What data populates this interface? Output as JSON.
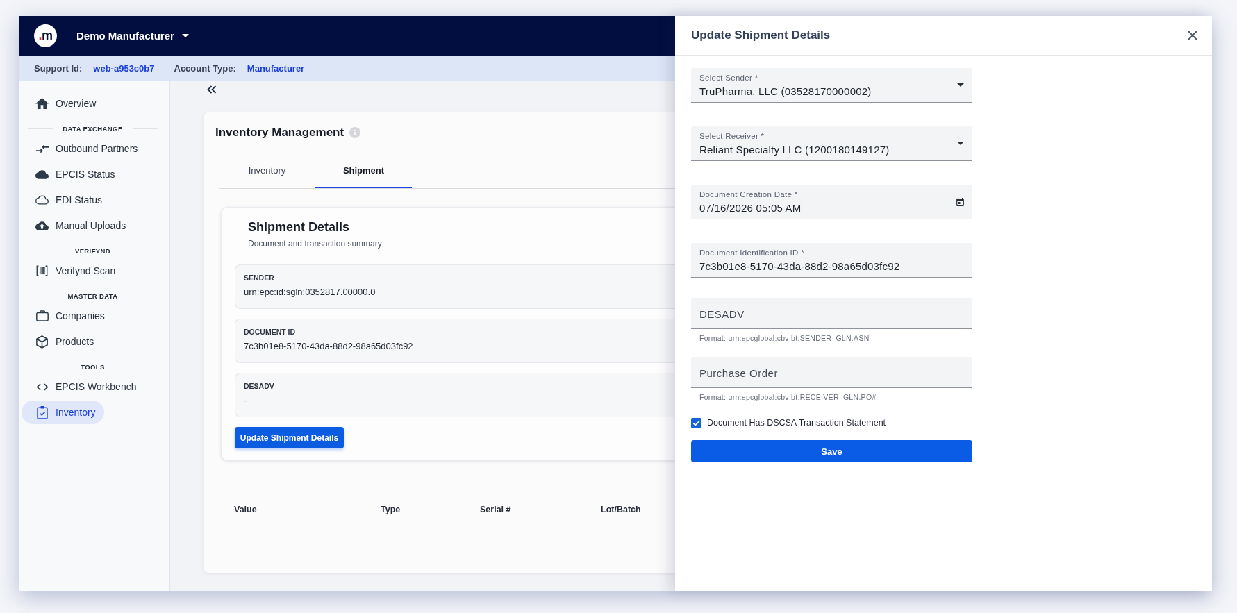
{
  "top_bar": {
    "logo": {
      "dot": ".",
      "letter": "m"
    },
    "organization": "Demo Manufacturer"
  },
  "account_bar": {
    "support_id_label": "Support Id:",
    "support_id": "web-a953c0b7",
    "account_type_label": "Account Type:",
    "account_type": "Manufacturer"
  },
  "sidebar": {
    "groups": [
      {
        "items": [
          {
            "label": "Overview",
            "selected": false
          }
        ]
      },
      {
        "heading": "DATA EXCHANGE",
        "items": [
          {
            "label": "Outbound Partners",
            "selected": false
          },
          {
            "label": "EPCIS Status",
            "selected": false
          },
          {
            "label": "EDI Status",
            "selected": false
          },
          {
            "label": "Manual Uploads",
            "selected": false
          }
        ]
      },
      {
        "heading": "VERIFYND",
        "items": [
          {
            "label": "Verifynd Scan",
            "selected": false
          }
        ]
      },
      {
        "heading": "MASTER DATA",
        "items": [
          {
            "label": "Companies",
            "selected": false
          },
          {
            "label": "Products",
            "selected": false
          }
        ]
      },
      {
        "heading": "TOOLS",
        "items": [
          {
            "label": "EPCIS Workbench",
            "selected": false
          },
          {
            "label": "Inventory",
            "selected": true
          }
        ]
      }
    ]
  },
  "inventory_card": {
    "title": "Inventory Management",
    "tabs": [
      {
        "label": "Inventory",
        "selected": false
      },
      {
        "label": "Shipment",
        "selected": true
      }
    ],
    "shipment_details": {
      "title": "Shipment Details",
      "subtitle": "Document and transaction summary",
      "fields": [
        {
          "label": "SENDER",
          "value": "urn:epc:id:sgln:0352817.00000.0"
        },
        {
          "label": "DOCUMENT ID",
          "value": "7c3b01e8-5170-43da-88d2-98a65d03fc92"
        },
        {
          "label": "DESADV",
          "value": "-"
        }
      ],
      "button": "Update Shipment Details"
    },
    "table": {
      "columns": [
        "Value",
        "Type",
        "Serial #",
        "Lot/Batch"
      ]
    }
  },
  "drawer": {
    "title": "Update Shipment Details",
    "fields": [
      {
        "kind": "select",
        "label": "Select Sender *",
        "value": "TruPharma, LLC (03528170000002)"
      },
      {
        "kind": "select",
        "label": "Select Receiver *",
        "value": "Reliant Specialty LLC (1200180149127)"
      },
      {
        "kind": "date",
        "label": "Document Creation Date *",
        "value": "07/16/2026 05:05 AM"
      },
      {
        "kind": "text",
        "label": "Document Identification ID *",
        "value": "7c3b01e8-5170-43da-88d2-98a65d03fc92"
      },
      {
        "kind": "text",
        "placeholder": "DESADV",
        "helper": "Format: urn:epcglobal:cbv:bt:SENDER_GLN.ASN"
      },
      {
        "kind": "text",
        "placeholder": "Purchase Order",
        "helper": "Format: urn:epcglobal:cbv:bt:RECEIVER_GLN.PO#"
      }
    ],
    "checkbox": {
      "label": "Document Has DSCSA Transaction Statement",
      "checked": true
    },
    "save_button": "Save"
  }
}
